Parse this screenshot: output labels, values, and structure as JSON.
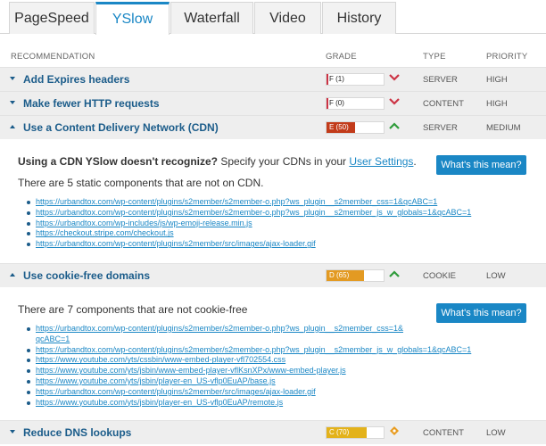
{
  "tabs": [
    {
      "label": "PageSpeed",
      "active": false
    },
    {
      "label": "YSlow",
      "active": true
    },
    {
      "label": "Waterfall",
      "active": false
    },
    {
      "label": "Video",
      "active": false
    },
    {
      "label": "History",
      "active": false
    }
  ],
  "columns": {
    "recommendation": "RECOMMENDATION",
    "grade": "GRADE",
    "type": "TYPE",
    "priority": "PRIORITY"
  },
  "rows": [
    {
      "title": "Add Expires headers",
      "grade": "F (1)",
      "score": 1,
      "color": "#cc3344",
      "trend": "down",
      "type": "SERVER",
      "priority": "HIGH",
      "expanded": false
    },
    {
      "title": "Make fewer HTTP requests",
      "grade": "F (0)",
      "score": 0,
      "color": "#cc3344",
      "trend": "down",
      "type": "CONTENT",
      "priority": "HIGH",
      "expanded": false
    },
    {
      "title": "Use a Content Delivery Network (CDN)",
      "grade": "E (50)",
      "score": 50,
      "color": "#c23b1a",
      "trend": "up",
      "type": "SERVER",
      "priority": "MEDIUM",
      "expanded": true
    },
    {
      "title": "Use cookie-free domains",
      "grade": "D (65)",
      "score": 65,
      "color": "#e39a22",
      "trend": "up",
      "type": "COOKIE",
      "priority": "LOW",
      "expanded": true
    },
    {
      "title": "Reduce DNS lookups",
      "grade": "C (70)",
      "score": 70,
      "color": "#e3b21b",
      "trend": "flat",
      "type": "CONTENT",
      "priority": "LOW",
      "expanded": false
    }
  ],
  "cdn_panel": {
    "heading": "Using a CDN YSlow doesn't recognize?",
    "heading_rest": " Specify your CDNs in your ",
    "settings_link": "User Settings",
    "period": ".",
    "summary": "There are 5 static components that are not on CDN.",
    "button": "What's this mean?",
    "urls": [
      "https://urbandtox.com/wp-content/plugins/s2member/s2member-o.php?ws_plugin__s2member_css=1&qcABC=1",
      "https://urbandtox.com/wp-content/plugins/s2member/s2member-o.php?ws_plugin__s2member_js_w_globals=1&qcABC=1",
      "https://urbandtox.com/wp-includes/js/wp-emoji-release.min.js",
      "https://checkout.stripe.com/checkout.js",
      "https://urbandtox.com/wp-content/plugins/s2member/src/images/ajax-loader.gif"
    ]
  },
  "cookie_panel": {
    "summary": "There are 7 components that are not cookie-free",
    "button": "What's this mean?",
    "urls": [
      "https://urbandtox.com/wp-content/plugins/s2member/s2member-o.php?ws_plugin__s2member_css=1&",
      "qcABC=1",
      "https://urbandtox.com/wp-content/plugins/s2member/s2member-o.php?ws_plugin__s2member_js_w_globals=1&qcABC=1",
      "https://www.youtube.com/yts/cssbin/www-embed-player-vfl702554.css",
      "https://www.youtube.com/yts/jsbin/www-embed-player-vflKsnXPx/www-embed-player.js",
      "https://www.youtube.com/yts/jsbin/player-en_US-vflp0EuAP/base.js",
      "https://urbandtox.com/wp-content/plugins/s2member/src/images/ajax-loader.gif",
      "https://www.youtube.com/yts/jsbin/player-en_US-vflp0EuAP/remote.js"
    ]
  }
}
